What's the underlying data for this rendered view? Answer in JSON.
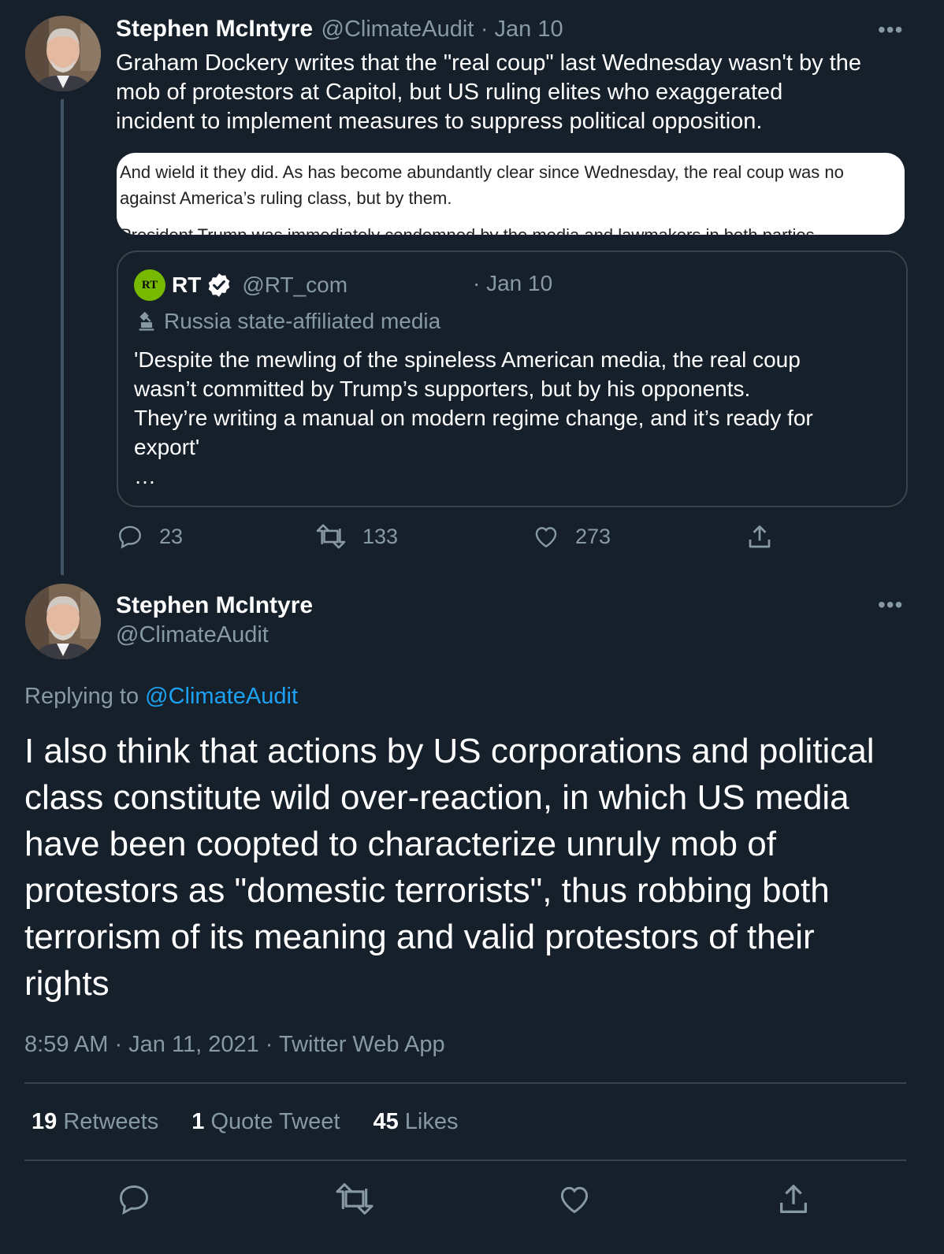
{
  "tweet1": {
    "author_name": "Stephen McIntyre",
    "author_handle": "@ClimateAudit",
    "date": "· Jan 10",
    "text_lines": [
      "Graham Dockery writes that the \"real coup\" last Wednesday wasn't by the",
      "mob of protestors at Capitol, but US ruling elites who exaggerated",
      "incident to implement measures to suppress  political opposition."
    ],
    "image_text_lines": [
      "And wield it they did. As has become abundantly clear since Wednesday, the real coup was no",
      "against America’s ruling class, but by them."
    ],
    "image_clipped_line": "President Trump was immediately condemned by the media and lawmakers in both parties",
    "quote": {
      "logo": "RT",
      "name": "RT",
      "handle": "@RT_com",
      "date": "· Jan 10",
      "label": "Russia state-affiliated media",
      "text_lines": [
        "'Despite the mewling of the spineless American media, the real coup",
        "wasn’t committed by Trump’s supporters, but by his opponents.",
        "They’re writing a manual on modern regime change, and it’s ready for",
        "export'"
      ],
      "ellipsis": "…"
    },
    "actions": {
      "replies": "23",
      "retweets": "133",
      "likes": "273"
    }
  },
  "tweet2": {
    "author_name": "Stephen McIntyre",
    "author_handle": "@ClimateAudit",
    "replying_prefix": "Replying to",
    "replying_handle": "@ClimateAudit",
    "text_lines": [
      "I also think that actions by US corporations and political",
      "class constitute wild over-reaction, in which US media",
      "have been coopted to characterize unruly mob of",
      "protestors as \"domestic terrorists\", thus robbing both",
      "terrorism of its meaning and valid protestors of their",
      "rights"
    ],
    "timestamp": "8:59 AM · Jan 11, 2021 · Twitter Web App",
    "stats": {
      "retweets_count": "19",
      "retweets_label": "Retweets",
      "quotes_count": "1",
      "quotes_label": "Quote Tweet",
      "likes_count": "45",
      "likes_label": "Likes"
    }
  },
  "icons": [
    "more-icon",
    "verified-icon",
    "state-media-icon",
    "reply-icon",
    "retweet-icon",
    "like-icon",
    "share-icon"
  ],
  "colors": {
    "background": "#15202b",
    "muted": "#8899a6",
    "link": "#1da1f2",
    "border": "#38444d",
    "rt_green": "#77b800"
  }
}
